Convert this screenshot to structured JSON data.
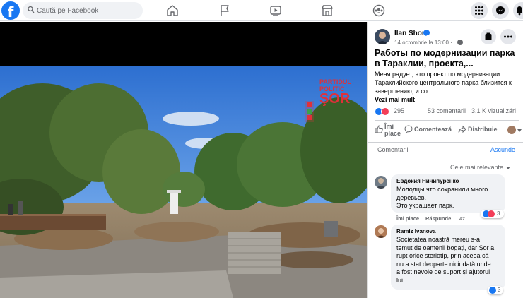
{
  "topbar": {
    "search_placeholder": "Caută pe Facebook",
    "nav": [
      "home-icon",
      "flag-icon",
      "video-icon",
      "marketplace-icon",
      "groups-icon"
    ],
    "right": [
      "menu-grid-icon",
      "messenger-icon",
      "bell-icon"
    ]
  },
  "video": {
    "overlay_line1": "PARTIDUL",
    "overlay_line2": "POLITIC",
    "overlay_logo": "ŞOR"
  },
  "post": {
    "author": "Ilan Shor",
    "date": "14 octombrie la 13:00 · ",
    "title": "Работы по модернизации парка в Тараклии, проекта,...",
    "body": "Меня радует, что проект по модернизации Тараклийского центрального парка близится к завершению, и со...",
    "see_more": "Vezi mai mult",
    "reactions_count": "295",
    "comments_count": "53 comentarii",
    "views": "3,1 K vizualizări",
    "actions": {
      "like": "Îmi place",
      "comment": "Comentează",
      "share": "Distribuie"
    }
  },
  "comments": {
    "header": "Comentarii",
    "hide": "Ascunde",
    "sort": "Cele mai relevante",
    "items": [
      {
        "name": "Евдокия Ничипуренко",
        "lines": [
          "Молодцы что сохранили много",
          "деревьев.",
          "Это украшает парк."
        ],
        "like": "Îmi place",
        "reply": "Răspunde",
        "time": "4z",
        "reactions": "3"
      },
      {
        "name": "Ramiz Ivanova",
        "lines": [
          "Societatea noastră mereu s-a",
          "temut de oamenii bogați, dar Șor a",
          "rupt orice steriotip, prin aceea că",
          "nu a stat deoparte niciodată unde",
          "a fost nevoie de suport și ajutorul",
          "lui."
        ],
        "reactions": "3"
      }
    ]
  },
  "colors": {
    "brand": "#1877f2",
    "overlay_red": "#e0303a"
  }
}
